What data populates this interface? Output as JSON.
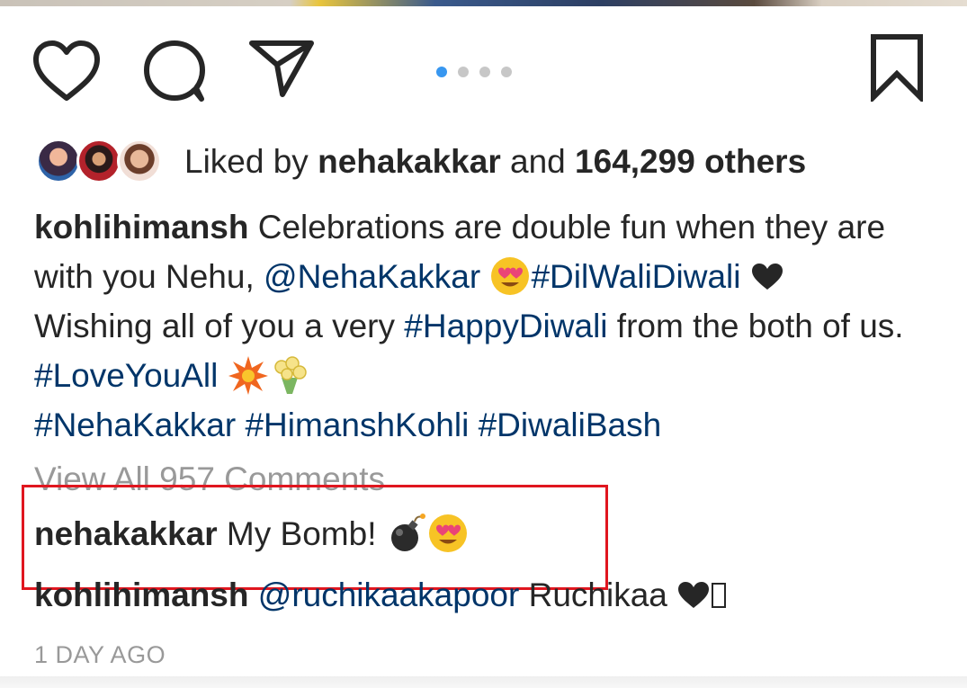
{
  "post": {
    "likes": {
      "prefix": "Liked by ",
      "user": "nehakakkar",
      "conj": " and ",
      "count": "164,299 others"
    },
    "carousel": {
      "total": 4,
      "active_index": 0
    },
    "caption": {
      "author": "kohlihimansh",
      "text1": " Celebrations are double fun when they are with you Nehu, ",
      "mention": "@NehaKakkar",
      "tag1": "#DilWaliDiwali",
      "text2": "Wishing all of you a very ",
      "tag2": "#HappyDiwali",
      "text3": " from the both of us. ",
      "tag3": "#LoveYouAll",
      "tag4": "#NehaKakkar",
      "tag5": "#HimanshKohli",
      "tag6": "#DiwaliBash"
    },
    "view_all": "View All 957 Comments",
    "comments": [
      {
        "user": "nehakakkar",
        "text": " My Bomb! "
      },
      {
        "user": "kohlihimansh",
        "mention": "@ruchikaakapoor",
        "text": " Ruchikaa "
      }
    ],
    "timestamp": "1 DAY AGO"
  },
  "icons": {
    "like": "heart-outline-icon",
    "comment": "comment-bubble-icon",
    "share": "paper-plane-icon",
    "save": "bookmark-outline-icon"
  },
  "colors": {
    "hashtag": "#003569",
    "muted": "#999999",
    "carousel_active": "#3897f0",
    "carousel_inactive": "#c7c7c7",
    "highlight_box": "#e0161f"
  }
}
